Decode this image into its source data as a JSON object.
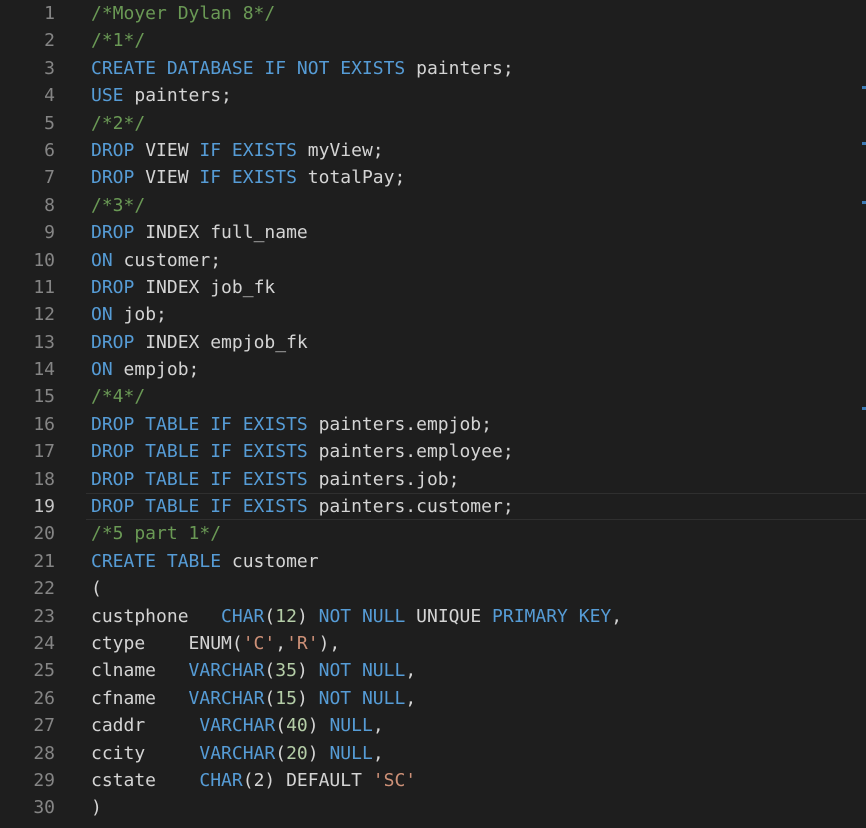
{
  "editor": {
    "current_line": 19,
    "lines": [
      {
        "number": "1",
        "tokens": [
          {
            "t": "comment",
            "v": "/*Moyer Dylan 8*/"
          }
        ]
      },
      {
        "number": "2",
        "tokens": [
          {
            "t": "comment",
            "v": "/*1*/"
          }
        ]
      },
      {
        "number": "3",
        "tokens": [
          {
            "t": "keyword",
            "v": "CREATE DATABASE IF NOT EXISTS"
          },
          {
            "t": "plain",
            "v": " painters;"
          }
        ]
      },
      {
        "number": "4",
        "tokens": [
          {
            "t": "keyword",
            "v": "USE"
          },
          {
            "t": "plain",
            "v": " painters;"
          }
        ]
      },
      {
        "number": "5",
        "tokens": [
          {
            "t": "comment",
            "v": "/*2*/"
          }
        ]
      },
      {
        "number": "6",
        "tokens": [
          {
            "t": "keyword",
            "v": "DROP"
          },
          {
            "t": "plain",
            "v": " VIEW "
          },
          {
            "t": "keyword",
            "v": "IF EXISTS"
          },
          {
            "t": "plain",
            "v": " myView;"
          }
        ]
      },
      {
        "number": "7",
        "tokens": [
          {
            "t": "keyword",
            "v": "DROP"
          },
          {
            "t": "plain",
            "v": " VIEW "
          },
          {
            "t": "keyword",
            "v": "IF EXISTS"
          },
          {
            "t": "plain",
            "v": " totalPay;"
          }
        ]
      },
      {
        "number": "8",
        "tokens": [
          {
            "t": "comment",
            "v": "/*3*/"
          }
        ]
      },
      {
        "number": "9",
        "tokens": [
          {
            "t": "keyword",
            "v": "DROP"
          },
          {
            "t": "plain",
            "v": " INDEX full_name"
          }
        ]
      },
      {
        "number": "10",
        "tokens": [
          {
            "t": "keyword",
            "v": "ON"
          },
          {
            "t": "plain",
            "v": " customer;"
          }
        ]
      },
      {
        "number": "11",
        "tokens": [
          {
            "t": "keyword",
            "v": "DROP"
          },
          {
            "t": "plain",
            "v": " INDEX job_fk"
          }
        ]
      },
      {
        "number": "12",
        "tokens": [
          {
            "t": "keyword",
            "v": "ON"
          },
          {
            "t": "plain",
            "v": " job;"
          }
        ]
      },
      {
        "number": "13",
        "tokens": [
          {
            "t": "keyword",
            "v": "DROP"
          },
          {
            "t": "plain",
            "v": " INDEX empjob_fk"
          }
        ]
      },
      {
        "number": "14",
        "tokens": [
          {
            "t": "keyword",
            "v": "ON"
          },
          {
            "t": "plain",
            "v": " empjob;"
          }
        ]
      },
      {
        "number": "15",
        "tokens": [
          {
            "t": "comment",
            "v": "/*4*/"
          }
        ]
      },
      {
        "number": "16",
        "tokens": [
          {
            "t": "keyword",
            "v": "DROP TABLE IF EXISTS"
          },
          {
            "t": "plain",
            "v": " painters.empjob;"
          }
        ]
      },
      {
        "number": "17",
        "tokens": [
          {
            "t": "keyword",
            "v": "DROP TABLE IF EXISTS"
          },
          {
            "t": "plain",
            "v": " painters.employee;"
          }
        ]
      },
      {
        "number": "18",
        "tokens": [
          {
            "t": "keyword",
            "v": "DROP TABLE IF EXISTS"
          },
          {
            "t": "plain",
            "v": " painters.job;"
          }
        ]
      },
      {
        "number": "19",
        "tokens": [
          {
            "t": "keyword",
            "v": "DROP TABLE IF EXISTS"
          },
          {
            "t": "plain",
            "v": " painters.customer;"
          }
        ]
      },
      {
        "number": "20",
        "tokens": [
          {
            "t": "comment",
            "v": "/*5 part 1*/"
          }
        ]
      },
      {
        "number": "21",
        "tokens": [
          {
            "t": "keyword",
            "v": "CREATE TABLE"
          },
          {
            "t": "plain",
            "v": " customer"
          }
        ]
      },
      {
        "number": "22",
        "tokens": [
          {
            "t": "plain",
            "v": "("
          }
        ]
      },
      {
        "number": "23",
        "tokens": [
          {
            "t": "plain",
            "v": "custphone   "
          },
          {
            "t": "keyword",
            "v": "CHAR"
          },
          {
            "t": "plain",
            "v": "("
          },
          {
            "t": "number",
            "v": "12"
          },
          {
            "t": "plain",
            "v": ") "
          },
          {
            "t": "keyword",
            "v": "NOT NULL"
          },
          {
            "t": "plain",
            "v": " UNIQUE "
          },
          {
            "t": "keyword",
            "v": "PRIMARY KEY"
          },
          {
            "t": "plain",
            "v": ","
          }
        ]
      },
      {
        "number": "24",
        "tokens": [
          {
            "t": "plain",
            "v": "ctype    ENUM("
          },
          {
            "t": "string",
            "v": "'C'"
          },
          {
            "t": "plain",
            "v": ","
          },
          {
            "t": "string",
            "v": "'R'"
          },
          {
            "t": "plain",
            "v": "),"
          }
        ]
      },
      {
        "number": "25",
        "tokens": [
          {
            "t": "plain",
            "v": "clname   "
          },
          {
            "t": "keyword",
            "v": "VARCHAR"
          },
          {
            "t": "plain",
            "v": "("
          },
          {
            "t": "number",
            "v": "35"
          },
          {
            "t": "plain",
            "v": ") "
          },
          {
            "t": "keyword",
            "v": "NOT NULL"
          },
          {
            "t": "plain",
            "v": ","
          }
        ]
      },
      {
        "number": "26",
        "tokens": [
          {
            "t": "plain",
            "v": "cfname   "
          },
          {
            "t": "keyword",
            "v": "VARCHAR"
          },
          {
            "t": "plain",
            "v": "("
          },
          {
            "t": "number",
            "v": "15"
          },
          {
            "t": "plain",
            "v": ") "
          },
          {
            "t": "keyword",
            "v": "NOT NULL"
          },
          {
            "t": "plain",
            "v": ","
          }
        ]
      },
      {
        "number": "27",
        "tokens": [
          {
            "t": "plain",
            "v": "caddr     "
          },
          {
            "t": "keyword",
            "v": "VARCHAR"
          },
          {
            "t": "plain",
            "v": "("
          },
          {
            "t": "number",
            "v": "40"
          },
          {
            "t": "plain",
            "v": ") "
          },
          {
            "t": "keyword",
            "v": "NULL"
          },
          {
            "t": "plain",
            "v": ","
          }
        ]
      },
      {
        "number": "28",
        "tokens": [
          {
            "t": "plain",
            "v": "ccity     "
          },
          {
            "t": "keyword",
            "v": "VARCHAR"
          },
          {
            "t": "plain",
            "v": "("
          },
          {
            "t": "number",
            "v": "20"
          },
          {
            "t": "plain",
            "v": ") "
          },
          {
            "t": "keyword",
            "v": "NULL"
          },
          {
            "t": "plain",
            "v": ","
          }
        ]
      },
      {
        "number": "29",
        "tokens": [
          {
            "t": "plain",
            "v": "cstate    "
          },
          {
            "t": "keyword",
            "v": "CHAR"
          },
          {
            "t": "plain",
            "v": "(2) DEFAULT "
          },
          {
            "t": "string",
            "v": "'SC'"
          }
        ]
      },
      {
        "number": "30",
        "tokens": [
          {
            "t": "plain",
            "v": ")"
          }
        ]
      }
    ]
  },
  "colors": {
    "background": "#1e1e1e",
    "comment": "#6a9955",
    "keyword": "#569cd6",
    "plain": "#d4d4d4",
    "number": "#b5cea8",
    "string": "#ce9178",
    "line_number": "#858585",
    "scrollbar_marker": "#3b7ab5"
  }
}
